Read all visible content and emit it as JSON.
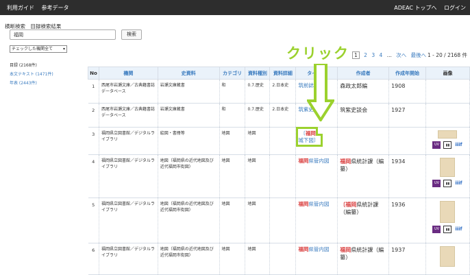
{
  "topbar": {
    "left_items": [
      "利用ガイド",
      "参考データ"
    ],
    "right_items": [
      "ADEAC トップへ",
      "ログイン"
    ]
  },
  "breadcrumb": [
    "横断検索",
    "目録検索結果"
  ],
  "search": {
    "value": "福岡",
    "button": "検索"
  },
  "select": {
    "value": "チェックした機関全て"
  },
  "facets": {
    "head": "目録 (2168件)",
    "links": [
      "本文テキスト (1471件)",
      "年表 (2443件)"
    ]
  },
  "annotation": {
    "click_label": "クリック"
  },
  "pager": {
    "current": "1",
    "pages": [
      "2",
      "3",
      "4"
    ],
    "dots": "...",
    "next": "次へ",
    "last": "最後へ",
    "count": "1 - 20 / 2168 件"
  },
  "table": {
    "headers": [
      "No",
      "機関",
      "史資料",
      "カテゴリ",
      "資料種別",
      "資料詳細",
      "タイトル",
      "作成者",
      "作成年開始",
      "画像"
    ],
    "rows": [
      {
        "no": "1",
        "inst": "西尾市岩瀬文庫／古典籍書誌データベース",
        "source": "岩瀬文庫蔵書",
        "cat": "和",
        "type": "0.7.歴史",
        "detail": "2.日本史",
        "title_pre": "筑前",
        "title_hl": "",
        "title_post": "誌",
        "author": "森政太郎編",
        "year": "1908"
      },
      {
        "no": "2",
        "inst": "西尾市岩瀬文庫／古典籍書誌データベース",
        "source": "岩瀬文庫蔵書",
        "cat": "和",
        "type": "0.7.歴史",
        "detail": "2.日本史",
        "title_pre": "筑紫史",
        "title_hl": "",
        "title_post": "",
        "author": "筑紫史談会",
        "year": "1927"
      },
      {
        "no": "3",
        "inst": "福岡県立図書館／デジタルライブラリ",
        "source": "絵図・書冊等",
        "cat": "地図",
        "type": "地図",
        "detail": "",
        "title_pre": "〔",
        "title_hl": "福岡",
        "title_post": "城下図〕",
        "author": "",
        "year": ""
      },
      {
        "no": "4",
        "inst": "福岡県立図書館／デジタルライブラリ",
        "source": "地図（福岡県の近代地図及び近代福岡市街図）",
        "cat": "地図",
        "type": "地図",
        "detail": "",
        "title_pre": "",
        "title_hl": "福岡",
        "title_post": "県管内図",
        "author_hl": "福岡",
        "author": "県統計課（編纂）",
        "year": "1934"
      },
      {
        "no": "5",
        "inst": "福岡県立図書館／デジタルライブラリ",
        "source": "地図（福岡県の近代地図及び近代福岡市街図）",
        "cat": "地図",
        "type": "地図",
        "detail": "",
        "title_pre": "",
        "title_hl": "福岡",
        "title_post": "県管内図",
        "author_hl": "〔福岡",
        "author": "県統計課（編纂）",
        "year": "1936"
      },
      {
        "no": "6",
        "inst": "福岡県立図書館／デジタルライブラリ",
        "source": "地図（福岡県の近代地図及び近代福岡市街図）",
        "cat": "地図",
        "type": "地図",
        "detail": "",
        "title_pre": "",
        "title_hl": "福岡",
        "title_post": "県管内図",
        "author_hl": "福岡",
        "author": "県統計課（編纂）",
        "year": "1937"
      }
    ]
  },
  "image_icons": {
    "uv": "UV",
    "iiif": "iiif"
  }
}
